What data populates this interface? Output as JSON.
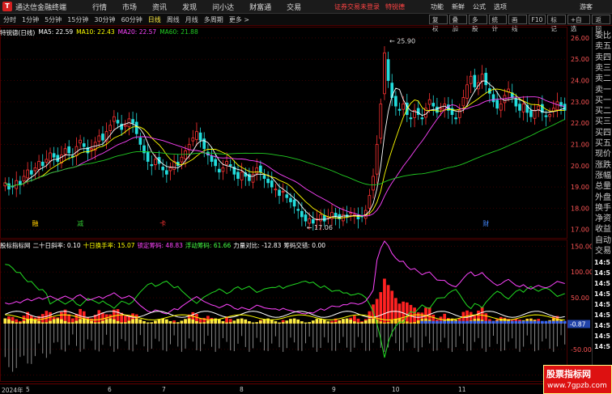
{
  "titlebar": {
    "logo_text": "T",
    "app_title": "通达信金融终端",
    "menu": [
      "行情",
      "市场",
      "资讯",
      "发现",
      "问小达",
      "财富通",
      "交易"
    ],
    "notice": "证券交易未登录",
    "stock_name": "特锐德",
    "right_menu": [
      "功能",
      "新鲜",
      "公式",
      "选项"
    ],
    "guest": "游客"
  },
  "periodbar": {
    "tabs": [
      "分时",
      "1分钟",
      "5分钟",
      "15分钟",
      "30分钟",
      "60分钟",
      "日线",
      "周线",
      "月线",
      "多周期",
      "更多 >"
    ],
    "active_tab": "日线",
    "tools": [
      "复权",
      "叠加",
      "多股",
      "统计",
      "画线",
      "F10",
      "标记",
      "+自选",
      "返回"
    ]
  },
  "main_info": {
    "title": "特锐德(日线)",
    "ma5": "MA5: 22.59",
    "ma10": "MA10: 22.43",
    "ma20": "MA20: 22.57",
    "ma60": "MA60: 21.88",
    "high_label": "25.90",
    "low_label": "17.06",
    "marks": [
      "融",
      "减",
      "卡",
      "财"
    ],
    "colors": {
      "ma5": "#ffffff",
      "ma10": "#ffff00",
      "ma20": "#ff44ff",
      "ma60": "#22cc22",
      "up": "#ff3333",
      "down": "#22dddd"
    }
  },
  "main_axis": {
    "ticks": [
      "26.00",
      "25.00",
      "24.00",
      "23.00",
      "22.00",
      "21.00",
      "20.00",
      "19.00",
      "18.00",
      "17.00"
    ]
  },
  "sub_info": {
    "title": "股标指标网",
    "f1": "二十日斜率: 0.10",
    "f2": "十日换手率: 15.07",
    "f3": "锁定筹码: 48.83",
    "f4": "浮动筹码: 61.66",
    "f5": "力量对比: -12.83",
    "f6": "筹码交错: 0.00",
    "colors": {
      "title": "#ffffff",
      "f1": "#ffffff",
      "f2": "#ffff00",
      "f3": "#ff44ff",
      "f4": "#44ff44",
      "f5": "#ffffff",
      "f6": "#ffffff"
    }
  },
  "sub_axis": {
    "ticks": [
      "150.00",
      "100.00",
      "50.00",
      "0.00",
      "-50.00",
      "-100.00"
    ],
    "current": "-0.87"
  },
  "right_panel": {
    "labels": [
      "委比",
      "卖五",
      "卖四",
      "卖三",
      "卖二",
      "卖一",
      "买一",
      "买二",
      "买三",
      "买四",
      "买五",
      "现价",
      "涨跌",
      "涨幅",
      "总量",
      "外盘",
      "换手",
      "净资",
      "收益",
      "自动",
      "交易"
    ],
    "times": [
      "14:5",
      "14:5",
      "14:5",
      "14:5",
      "14:5",
      "14:5",
      "14:5",
      "14:5",
      "14:5"
    ]
  },
  "xaxis": {
    "labels": [
      "2024年",
      "5",
      "6",
      "7",
      "8",
      "9",
      "10",
      "11"
    ]
  },
  "watermark": {
    "line1": "股票指标网",
    "line2": "www.7gpzb.com"
  },
  "chart_data": [
    {
      "type": "candlestick",
      "title": "特锐德(日线)",
      "ylim": [
        16.8,
        26.3
      ],
      "y_ticks": [
        17,
        18,
        19,
        20,
        21,
        22,
        23,
        24,
        25,
        26
      ],
      "x_month_labels": [
        "5",
        "6",
        "7",
        "8",
        "9",
        "10",
        "11"
      ],
      "high": 25.9,
      "low": 17.06,
      "series": [
        {
          "name": "MA5",
          "last": 22.59
        },
        {
          "name": "MA10",
          "last": 22.43
        },
        {
          "name": "MA20",
          "last": 22.57
        },
        {
          "name": "MA60",
          "last": 21.88
        }
      ],
      "close": [
        19.2,
        18.9,
        19.0,
        19.3,
        19.1,
        19.5,
        19.8,
        19.6,
        19.9,
        20.2,
        20.0,
        20.3,
        20.6,
        20.4,
        20.2,
        20.5,
        20.8,
        20.6,
        20.4,
        20.9,
        21.2,
        20.9,
        20.6,
        20.8,
        21.1,
        21.4,
        21.2,
        21.6,
        21.9,
        22.3,
        22.0,
        21.7,
        21.9,
        22.2,
        22.0,
        21.5,
        21.0,
        20.6,
        20.2,
        20.0,
        20.3,
        20.1,
        19.8,
        19.6,
        19.9,
        20.2,
        20.0,
        20.4,
        20.7,
        21.0,
        21.3,
        21.6,
        21.2,
        20.8,
        20.5,
        20.2,
        20.0,
        19.7,
        19.9,
        20.2,
        20.0,
        19.6,
        19.4,
        19.7,
        19.5,
        19.3,
        19.6,
        19.9,
        19.7,
        19.4,
        19.2,
        19.0,
        18.9,
        18.6,
        18.8,
        18.5,
        18.3,
        18.1,
        17.9,
        17.6,
        17.4,
        17.5,
        17.3,
        17.5,
        17.7,
        17.4,
        17.6,
        17.8,
        17.6,
        17.5,
        17.7,
        17.6,
        17.8,
        17.7,
        17.5,
        17.6,
        17.9,
        18.6,
        19.5,
        21.0,
        22.9,
        25.3,
        24.0,
        23.2,
        22.8,
        22.6,
        22.9,
        22.4,
        22.2,
        22.6,
        22.4,
        22.2,
        22.7,
        23.1,
        22.8,
        22.5,
        22.7,
        22.9,
        22.6,
        22.4,
        22.2,
        22.6,
        23.2,
        23.8,
        24.2,
        23.7,
        23.9,
        24.3,
        23.8,
        23.4,
        23.0,
        22.7,
        22.9,
        23.3,
        23.6,
        23.2,
        22.8,
        22.6,
        22.9,
        22.5,
        22.3,
        22.6,
        22.8,
        22.5,
        22.3,
        22.4,
        22.7,
        23.0,
        22.8,
        22.6
      ]
    },
    {
      "type": "bar",
      "title": "股标指标网",
      "ylim": [
        -110,
        160
      ],
      "y_ticks": [
        150,
        100,
        50,
        0,
        -50,
        -100
      ],
      "series": [
        {
          "name": "二十日斜率",
          "last": 0.1
        },
        {
          "name": "十日换手率",
          "last": 15.07
        },
        {
          "name": "锁定筹码",
          "last": 48.83
        },
        {
          "name": "浮动筹码",
          "last": 61.66
        },
        {
          "name": "力量对比",
          "last": -12.83
        },
        {
          "name": "筹码交错",
          "last": 0.0
        }
      ],
      "current_value": -0.87
    }
  ]
}
